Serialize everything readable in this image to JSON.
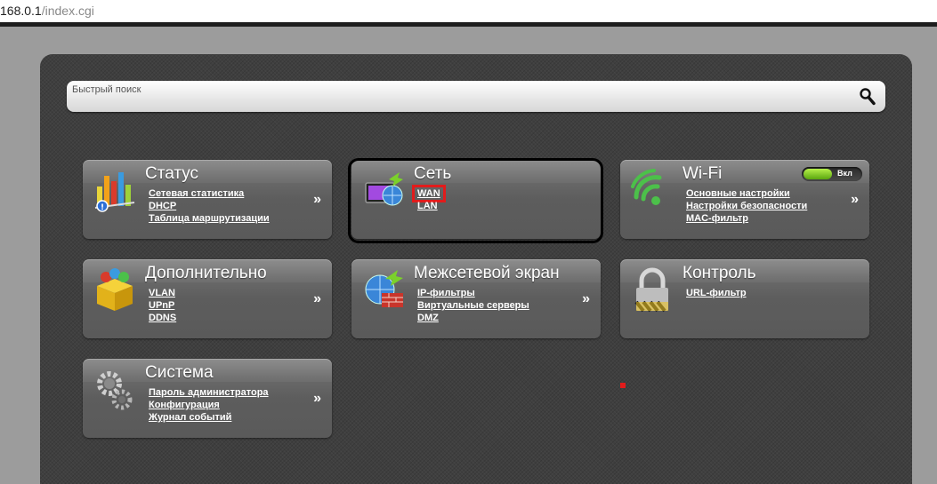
{
  "browser": {
    "url_host": "168.0.1",
    "url_path": "/index.cgi"
  },
  "search": {
    "placeholder": "Быстрый поиск"
  },
  "tiles": {
    "status": {
      "title": "Статус",
      "links": [
        "Сетевая статистика",
        "DHCP",
        "Таблица маршрутизации"
      ],
      "more": "»"
    },
    "network": {
      "title": "Сеть",
      "links": [
        "WAN",
        "LAN"
      ]
    },
    "wifi": {
      "title": "Wi-Fi",
      "toggle_state": "Вкл",
      "links": [
        "Основные настройки",
        "Настройки безопасности",
        "MAC-фильтр"
      ],
      "more": "»"
    },
    "advanced": {
      "title": "Дополнительно",
      "links": [
        "VLAN",
        "UPnP",
        "DDNS"
      ],
      "more": "»"
    },
    "firewall": {
      "title": "Межсетевой экран",
      "links": [
        "IP-фильтры",
        "Виртуальные серверы",
        "DMZ"
      ],
      "more": "»"
    },
    "control": {
      "title": "Контроль",
      "links": [
        "URL-фильтр"
      ]
    },
    "system": {
      "title": "Система",
      "links": [
        "Пароль администратора",
        "Конфигурация",
        "Журнал событий"
      ],
      "more": "»"
    }
  },
  "colors": {
    "highlight": "#e21b1b",
    "toggle_on": "#7bd12a",
    "panel": "#3f3f3f"
  }
}
